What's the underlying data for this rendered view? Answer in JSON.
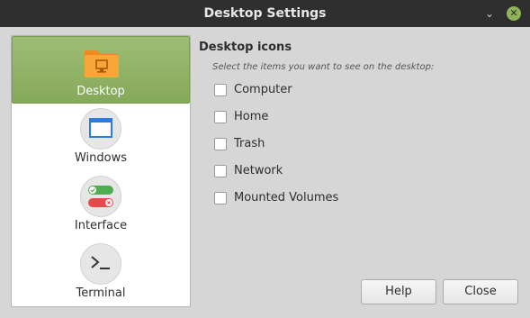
{
  "window": {
    "title": "Desktop Settings"
  },
  "titlebar_buttons": {
    "minimize": "⌄",
    "close": "✕"
  },
  "sidebar": {
    "items": [
      {
        "label": "Desktop",
        "icon": "folder-desktop-icon",
        "active": true
      },
      {
        "label": "Windows",
        "icon": "window-icon",
        "active": false
      },
      {
        "label": "Interface",
        "icon": "toggle-switches-icon",
        "active": false
      },
      {
        "label": "Terminal",
        "icon": "terminal-icon",
        "active": false
      }
    ]
  },
  "main": {
    "heading": "Desktop icons",
    "subtitle": "Select the items you want to see on the desktop:",
    "checkboxes": [
      {
        "label": "Computer",
        "checked": false
      },
      {
        "label": "Home",
        "checked": false
      },
      {
        "label": "Trash",
        "checked": false
      },
      {
        "label": "Network",
        "checked": false
      },
      {
        "label": "Mounted Volumes",
        "checked": false
      }
    ]
  },
  "buttons": {
    "help": "Help",
    "close": "Close"
  },
  "colors": {
    "accent": "#8fb359",
    "titlebar": "#2f2f2f",
    "background": "#d6d6d6"
  }
}
